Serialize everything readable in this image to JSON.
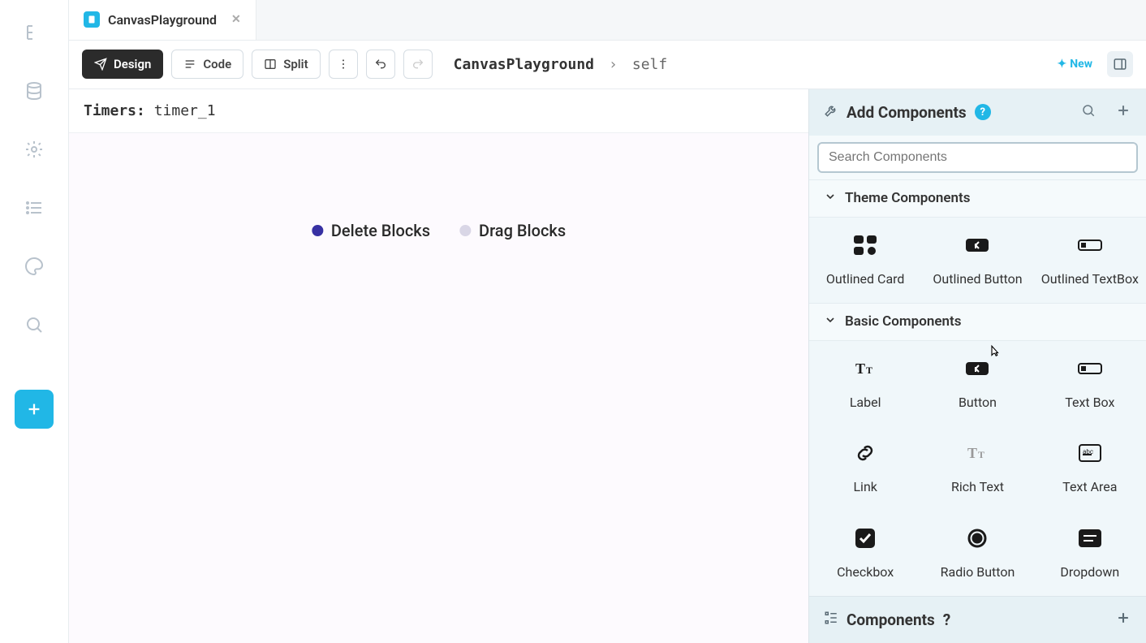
{
  "tab": {
    "title": "CanvasPlayground"
  },
  "toolbar": {
    "design_label": "Design",
    "code_label": "Code",
    "split_label": "Split",
    "new_label": "New"
  },
  "breadcrumb": {
    "root": "CanvasPlayground",
    "leaf": "self"
  },
  "timers": {
    "label": "Timers:",
    "value": "timer_1"
  },
  "legend": {
    "delete": "Delete Blocks",
    "drag": "Drag Blocks"
  },
  "panel": {
    "add_title": "Add Components",
    "search_placeholder": "Search Components",
    "section_theme": "Theme Components",
    "section_basic": "Basic Components",
    "footer_title": "Components",
    "theme_components": [
      {
        "label": "Outlined Card"
      },
      {
        "label": "Outlined Button"
      },
      {
        "label": "Outlined TextBox"
      }
    ],
    "basic_components": [
      {
        "label": "Label"
      },
      {
        "label": "Button"
      },
      {
        "label": "Text Box"
      },
      {
        "label": "Link"
      },
      {
        "label": "Rich Text"
      },
      {
        "label": "Text Area"
      },
      {
        "label": "Checkbox"
      },
      {
        "label": "Radio Button"
      },
      {
        "label": "Dropdown"
      }
    ]
  }
}
